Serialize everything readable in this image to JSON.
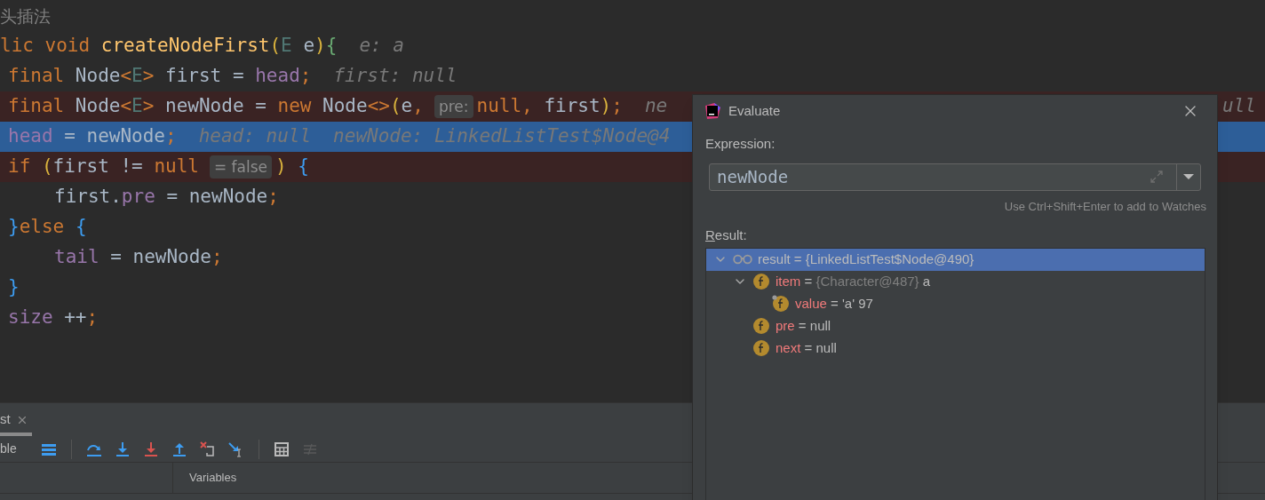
{
  "editor": {
    "lines": [
      {
        "breakpoint": false,
        "execution_point": false,
        "segments": [
          {
            "kind": "comment",
            "text": "头插法"
          }
        ]
      },
      {
        "breakpoint": false,
        "execution_point": false,
        "segments": [
          {
            "kind": "code",
            "tokens": [
              {
                "kind": "kw",
                "text": "lic void "
              },
              {
                "kind": "method",
                "text": "createNodeFirst"
              },
              {
                "kind": "paren",
                "text": "("
              },
              {
                "kind": "typeparam",
                "text": "E"
              },
              {
                "kind": "plain",
                "text": " e"
              },
              {
                "kind": "paren",
                "text": ")"
              },
              {
                "kind": "brace2",
                "text": "{"
              }
            ]
          },
          {
            "kind": "hint",
            "text": "e: a"
          }
        ],
        "children": [
          {
            "breakpoint": false,
            "execution_point": false,
            "segments": [
              {
                "kind": "code",
                "tokens": [
                  {
                    "kind": "kw",
                    "text": "final "
                  },
                  {
                    "kind": "plain",
                    "text": "Node"
                  },
                  {
                    "kind": "kw",
                    "text": "<"
                  },
                  {
                    "kind": "typeparam",
                    "text": "E"
                  },
                  {
                    "kind": "kw",
                    "text": ">"
                  },
                  {
                    "kind": "plain",
                    "text": " first = "
                  },
                  {
                    "kind": "field",
                    "text": "head"
                  },
                  {
                    "kind": "kw",
                    "text": ";"
                  }
                ]
              },
              {
                "kind": "hint",
                "text": "first: null"
              }
            ]
          },
          {
            "breakpoint": true,
            "execution_point": false,
            "segments": [
              {
                "kind": "code",
                "tokens": [
                  {
                    "kind": "kw",
                    "text": "final "
                  },
                  {
                    "kind": "plain",
                    "text": "Node"
                  },
                  {
                    "kind": "kw",
                    "text": "<"
                  },
                  {
                    "kind": "typeparam",
                    "text": "E"
                  },
                  {
                    "kind": "kw",
                    "text": ">"
                  },
                  {
                    "kind": "plain",
                    "text": " newNode = "
                  },
                  {
                    "kind": "kw",
                    "text": "new "
                  },
                  {
                    "kind": "plain",
                    "text": "Node"
                  },
                  {
                    "kind": "kw",
                    "text": "<>"
                  },
                  {
                    "kind": "paren",
                    "text": "("
                  },
                  {
                    "kind": "plain",
                    "text": "e"
                  },
                  {
                    "kind": "kw",
                    "text": ","
                  }
                ]
              },
              {
                "kind": "inlay",
                "text": "pre:"
              },
              {
                "kind": "code",
                "tokens": [
                  {
                    "kind": "kw",
                    "text": "null"
                  },
                  {
                    "kind": "kw",
                    "text": ", "
                  },
                  {
                    "kind": "plain",
                    "text": "first"
                  },
                  {
                    "kind": "paren",
                    "text": ")"
                  },
                  {
                    "kind": "kw",
                    "text": ";"
                  }
                ]
              },
              {
                "kind": "hint",
                "text": "ne"
              },
              {
                "kind": "trailing",
                "text": "ull"
              }
            ]
          },
          {
            "breakpoint": false,
            "execution_point": true,
            "segments": [
              {
                "kind": "code",
                "tokens": [
                  {
                    "kind": "field",
                    "text": "head"
                  },
                  {
                    "kind": "plain",
                    "text": " = newNode"
                  },
                  {
                    "kind": "kw",
                    "text": ";"
                  }
                ]
              },
              {
                "kind": "hint",
                "text": "head: null"
              },
              {
                "kind": "hint",
                "text": "newNode: LinkedListTest$Node@4"
              }
            ]
          },
          {
            "breakpoint": true,
            "execution_point": false,
            "segments": [
              {
                "kind": "code",
                "tokens": [
                  {
                    "kind": "kw",
                    "text": "if "
                  },
                  {
                    "kind": "paren",
                    "text": "("
                  },
                  {
                    "kind": "plain",
                    "text": "first != "
                  },
                  {
                    "kind": "kw",
                    "text": "null"
                  }
                ]
              },
              {
                "kind": "inlay",
                "text": "= false"
              },
              {
                "kind": "code",
                "tokens": [
                  {
                    "kind": "paren",
                    "text": ")"
                  },
                  {
                    "kind": "brace1",
                    "text": " {"
                  }
                ]
              }
            ],
            "children": [
              {
                "breakpoint": false,
                "execution_point": false,
                "segments": [
                  {
                    "kind": "code",
                    "tokens": [
                      {
                        "kind": "plain",
                        "text": "first."
                      },
                      {
                        "kind": "field",
                        "text": "pre"
                      },
                      {
                        "kind": "plain",
                        "text": " = newNode"
                      },
                      {
                        "kind": "kw",
                        "text": ";"
                      }
                    ]
                  }
                ]
              }
            ]
          },
          {
            "breakpoint": false,
            "execution_point": false,
            "segments": [
              {
                "kind": "code",
                "tokens": [
                  {
                    "kind": "brace1",
                    "text": "}"
                  },
                  {
                    "kind": "kw",
                    "text": "else "
                  },
                  {
                    "kind": "brace1",
                    "text": "{"
                  }
                ]
              }
            ],
            "children": [
              {
                "breakpoint": false,
                "execution_point": false,
                "segments": [
                  {
                    "kind": "code",
                    "tokens": [
                      {
                        "kind": "field",
                        "text": "tail"
                      },
                      {
                        "kind": "plain",
                        "text": " = newNode"
                      },
                      {
                        "kind": "kw",
                        "text": ";"
                      }
                    ]
                  }
                ]
              }
            ]
          },
          {
            "breakpoint": false,
            "execution_point": false,
            "segments": [
              {
                "kind": "code",
                "tokens": [
                  {
                    "kind": "brace1",
                    "text": "}"
                  }
                ]
              }
            ]
          },
          {
            "breakpoint": false,
            "execution_point": false,
            "segments": [
              {
                "kind": "code",
                "tokens": [
                  {
                    "kind": "field",
                    "text": "size"
                  },
                  {
                    "kind": "plain",
                    "text": " ++"
                  },
                  {
                    "kind": "kw",
                    "text": ";"
                  }
                ]
              }
            ]
          }
        ]
      }
    ]
  },
  "debug_panel": {
    "tabs": [
      {
        "label": "st",
        "selected": true
      }
    ],
    "toolbar": {
      "label": "ble",
      "groups": [
        [
          {
            "kind": "list",
            "disabled": false
          }
        ],
        [
          {
            "kind": "step-over",
            "disabled": false
          },
          {
            "kind": "step-into",
            "disabled": false
          },
          {
            "kind": "force-step-into",
            "disabled": false
          },
          {
            "kind": "step-out",
            "disabled": false
          },
          {
            "kind": "drop-frame",
            "disabled": false
          },
          {
            "kind": "run-to-cursor",
            "disabled": false
          }
        ],
        [
          {
            "kind": "evaluate",
            "disabled": false
          },
          {
            "kind": "trace",
            "disabled": true
          }
        ]
      ]
    },
    "variables_header": "Variables"
  },
  "dialog": {
    "title": "Evaluate",
    "expression_label": "Expression:",
    "expression": "newNode",
    "hint": "Use Ctrl+Shift+Enter to add to Watches",
    "result_label": "Result:",
    "tree": [
      {
        "kind": "watch",
        "name": "result",
        "operator": "=",
        "value": "{LinkedListTest$Node@490}",
        "selected": true,
        "expanded": true,
        "children": [
          {
            "kind": "field",
            "name": "item",
            "operator": "=",
            "type_ref": "{Character@487}",
            "value": "a",
            "selected": false,
            "expanded": true,
            "children": [
              {
                "kind": "final-field",
                "name": "value",
                "operator": "=",
                "value": "'a' 97",
                "selected": false
              }
            ]
          },
          {
            "kind": "field",
            "name": "pre",
            "operator": "=",
            "value": "null",
            "selected": false
          },
          {
            "kind": "field",
            "name": "next",
            "operator": "=",
            "value": "null",
            "selected": false
          }
        ]
      }
    ]
  }
}
